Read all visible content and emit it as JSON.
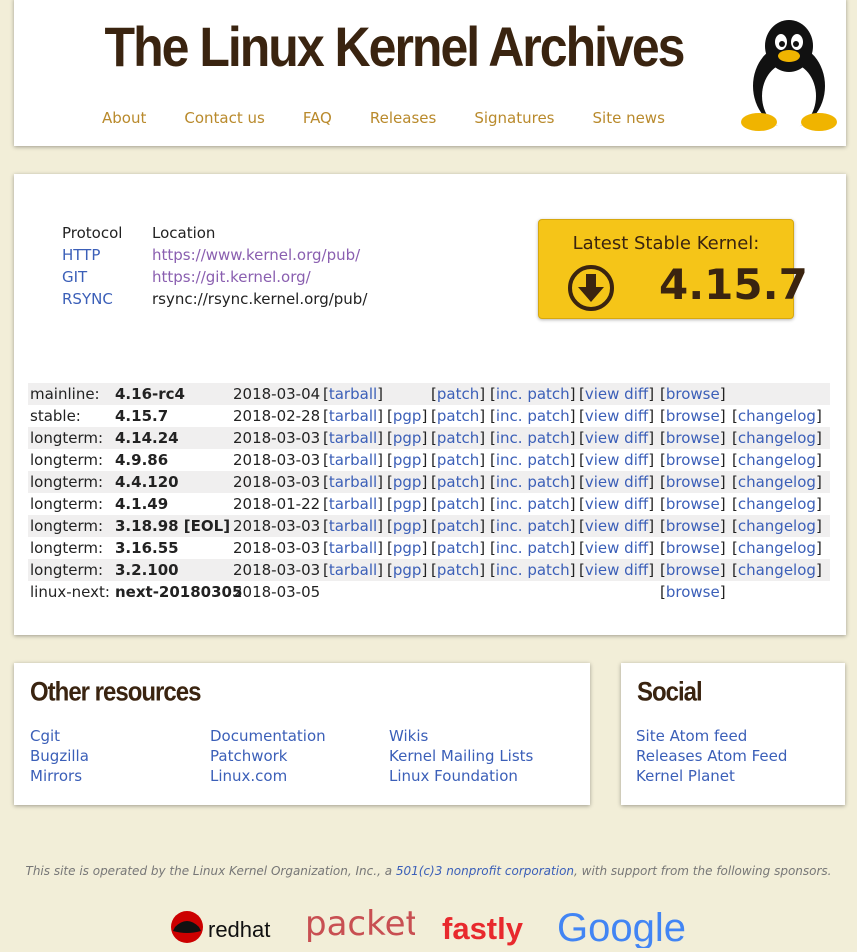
{
  "header": {
    "title": "The Linux Kernel Archives",
    "nav": [
      "About",
      "Contact us",
      "FAQ",
      "Releases",
      "Signatures",
      "Site news"
    ]
  },
  "protocols": {
    "header_protocol": "Protocol",
    "header_location": "Location",
    "rows": [
      {
        "name": "HTTP",
        "location": "https://www.kernel.org/pub/"
      },
      {
        "name": "GIT",
        "location": "https://git.kernel.org/"
      },
      {
        "name": "RSYNC",
        "location": "rsync://rsync.kernel.org/pub/"
      }
    ]
  },
  "latest": {
    "label": "Latest Stable Kernel:",
    "version": "4.15.7"
  },
  "link_labels": {
    "tarball": "tarball",
    "pgp": "pgp",
    "patch": "patch",
    "inc_patch": "inc. patch",
    "view_diff": "view diff",
    "browse": "browse",
    "changelog": "changelog"
  },
  "releases": [
    {
      "kind": "mainline:",
      "version": "4.16-rc4",
      "date": "2018-03-04",
      "links": [
        "tarball",
        "patch",
        "inc_patch",
        "view_diff",
        "browse"
      ]
    },
    {
      "kind": "stable:",
      "version": "4.15.7",
      "date": "2018-02-28",
      "links": [
        "tarball",
        "pgp",
        "patch",
        "inc_patch",
        "view_diff",
        "browse",
        "changelog"
      ]
    },
    {
      "kind": "longterm:",
      "version": "4.14.24",
      "date": "2018-03-03",
      "links": [
        "tarball",
        "pgp",
        "patch",
        "inc_patch",
        "view_diff",
        "browse",
        "changelog"
      ]
    },
    {
      "kind": "longterm:",
      "version": "4.9.86",
      "date": "2018-03-03",
      "links": [
        "tarball",
        "pgp",
        "patch",
        "inc_patch",
        "view_diff",
        "browse",
        "changelog"
      ]
    },
    {
      "kind": "longterm:",
      "version": "4.4.120",
      "date": "2018-03-03",
      "links": [
        "tarball",
        "pgp",
        "patch",
        "inc_patch",
        "view_diff",
        "browse",
        "changelog"
      ]
    },
    {
      "kind": "longterm:",
      "version": "4.1.49",
      "date": "2018-01-22",
      "links": [
        "tarball",
        "pgp",
        "patch",
        "inc_patch",
        "view_diff",
        "browse",
        "changelog"
      ]
    },
    {
      "kind": "longterm:",
      "version": "3.18.98 [EOL]",
      "date": "2018-03-03",
      "links": [
        "tarball",
        "pgp",
        "patch",
        "inc_patch",
        "view_diff",
        "browse",
        "changelog"
      ]
    },
    {
      "kind": "longterm:",
      "version": "3.16.55",
      "date": "2018-03-03",
      "links": [
        "tarball",
        "pgp",
        "patch",
        "inc_patch",
        "view_diff",
        "browse",
        "changelog"
      ]
    },
    {
      "kind": "longterm:",
      "version": "3.2.100",
      "date": "2018-03-03",
      "links": [
        "tarball",
        "pgp",
        "patch",
        "inc_patch",
        "view_diff",
        "browse",
        "changelog"
      ]
    },
    {
      "kind": "linux-next:",
      "version": "next-20180305",
      "date": "2018-03-05",
      "links": [
        "browse"
      ]
    }
  ],
  "other_resources": {
    "title": "Other resources",
    "columns": [
      [
        "Cgit",
        "Bugzilla",
        "Mirrors"
      ],
      [
        "Documentation",
        "Patchwork",
        "Linux.com"
      ],
      [
        "Wikis",
        "Kernel Mailing Lists",
        "Linux Foundation"
      ]
    ]
  },
  "social": {
    "title": "Social",
    "links": [
      "Site Atom feed",
      "Releases Atom Feed",
      "Kernel Planet"
    ]
  },
  "footer": {
    "text_before": "This site is operated by the Linux Kernel Organization, Inc., a ",
    "link": "501(c)3 nonprofit corporation",
    "text_after": ", with support from the following sponsors."
  },
  "sponsors": [
    "redhat",
    "packet",
    "fastly",
    "Google"
  ],
  "colors": {
    "background": "#f2eed8",
    "link": "#3b5fb8",
    "nav": "#b98a2c",
    "title": "#3a2410",
    "latest_box": "#f5c518"
  }
}
